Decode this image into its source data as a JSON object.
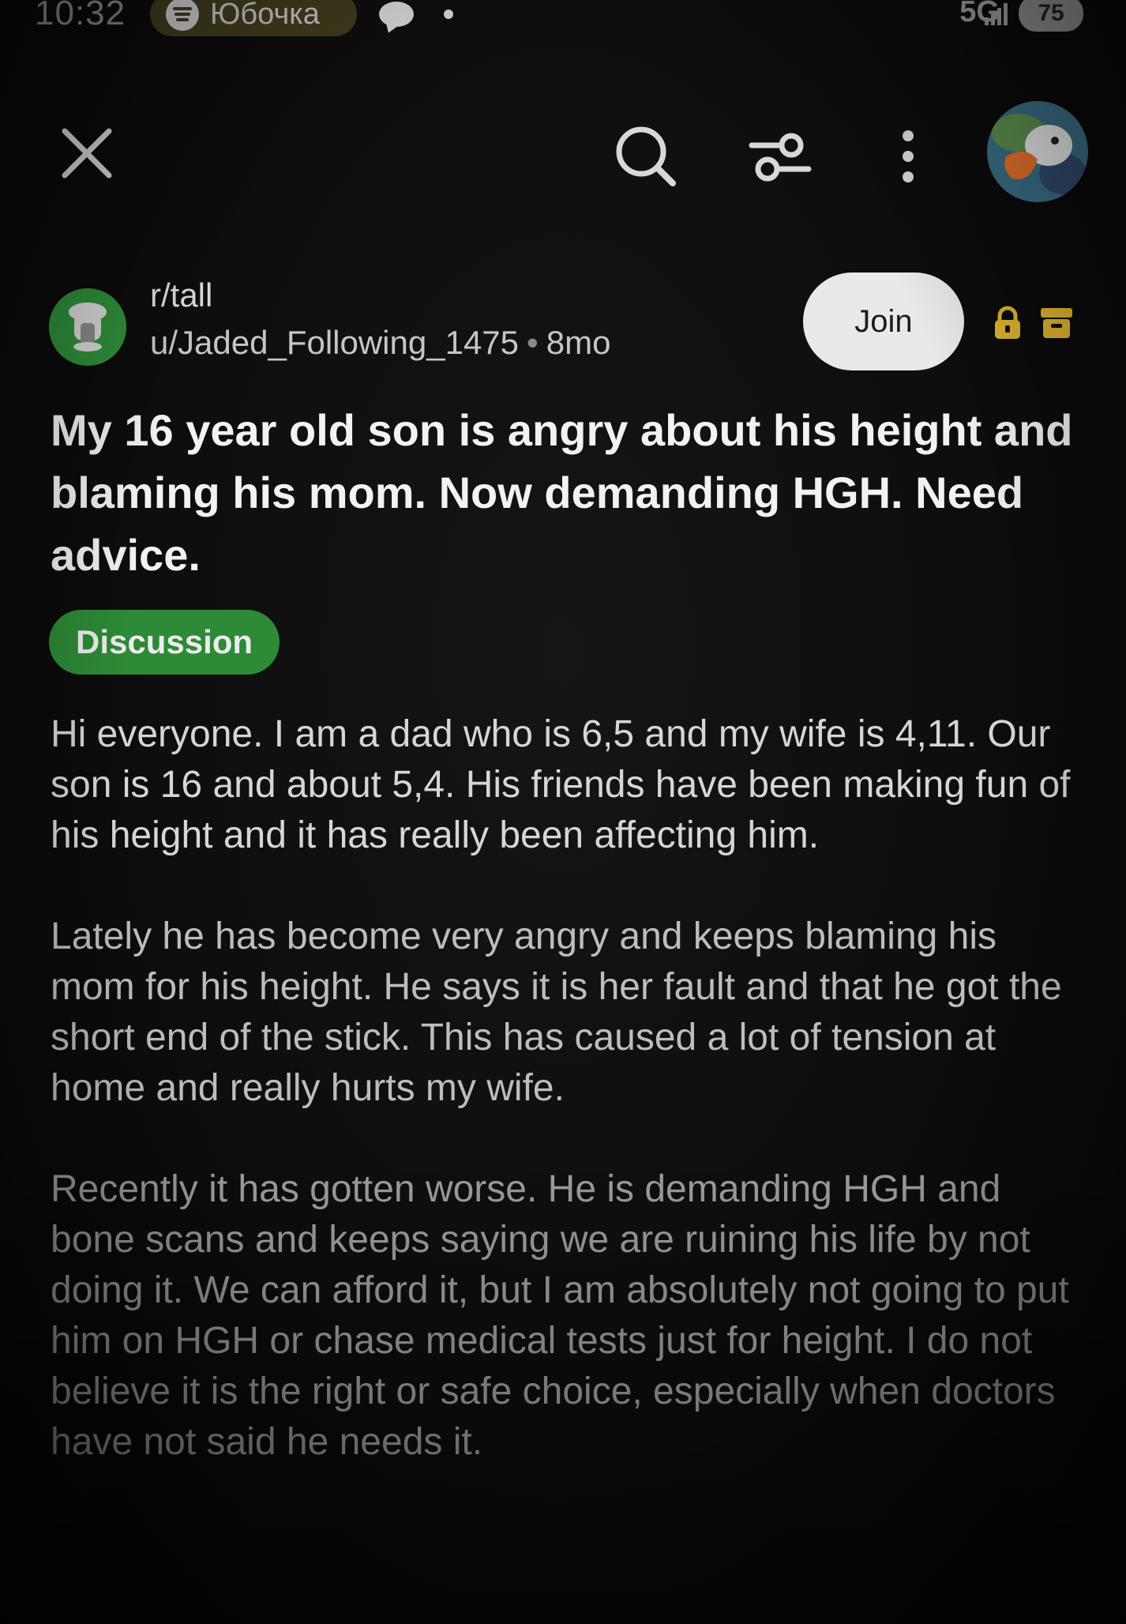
{
  "status_bar": {
    "time": "10:32",
    "media_pill_text": "Юбочка",
    "network": "5G",
    "battery": "75"
  },
  "toolbar": {
    "close_icon": "close-icon",
    "search_icon": "search-icon",
    "filter_icon": "filter-icon",
    "more_icon": "more-vertical-icon",
    "avatar_icon": "user-avatar"
  },
  "post": {
    "subreddit": "r/tall",
    "author": "u/Jaded_Following_1475",
    "separator": "•",
    "age": "8mo",
    "join_label": "Join",
    "title": "My 16 year old son is angry about his height and blaming his mom. Now demanding HGH. Need advice.",
    "flair": "Discussion",
    "body": [
      "Hi everyone. I am a dad who is 6,5 and my wife is 4,11. Our son is 16 and about 5,4. His friends have been making fun of his height and it has really been affecting him.",
      "Lately he has become very angry and keeps blaming his mom for his height. He says it is her fault and that he got the short end of the stick. This has caused a lot of tension at home and really hurts my wife.",
      "Recently it has gotten worse. He is demanding HGH and bone scans and keeps saying we are ruining his life by not doing it. We can afford it, but I am absolutely not going to put him on HGH or chase medical tests just for height. I do not believe it is the right or safe choice, especially when doctors have not said he needs it."
    ]
  },
  "colors": {
    "background": "#0b0b0b",
    "flair_green": "#2d8a36",
    "subreddit_icon_green": "#2f8f3a",
    "lock_yellow": "#e0b530",
    "join_button": "#e9e9e9"
  }
}
